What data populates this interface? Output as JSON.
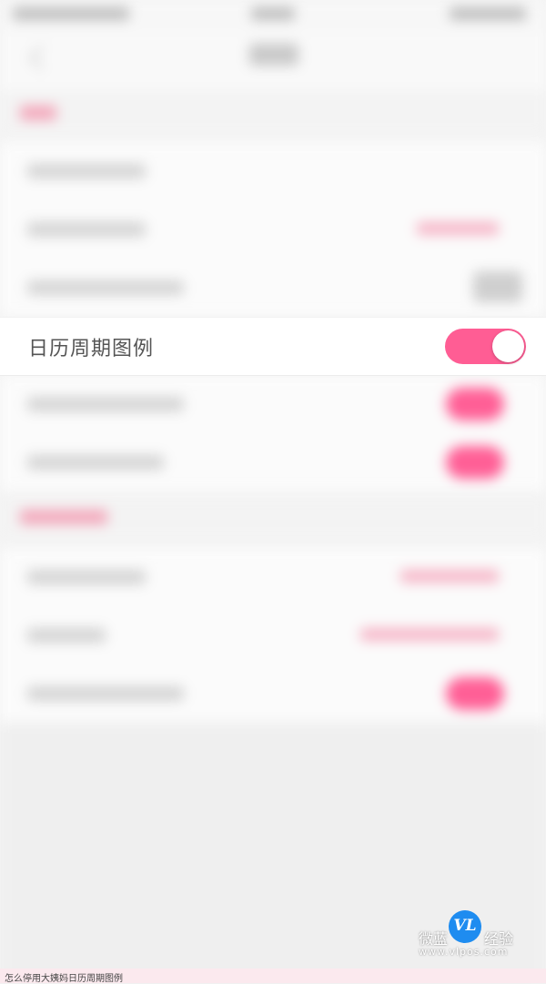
{
  "settings": {
    "calendar_legend_label": "日历周期图例",
    "calendar_legend_enabled": true
  },
  "watermark": {
    "left_text": "微蓝",
    "logo_text": "VL",
    "right_text": "经验",
    "url": "www.vlpos.com"
  },
  "caption": "怎么停用大姨妈日历周期图例",
  "colors": {
    "accent": "#ff5d94",
    "background": "#f4f4f4"
  }
}
